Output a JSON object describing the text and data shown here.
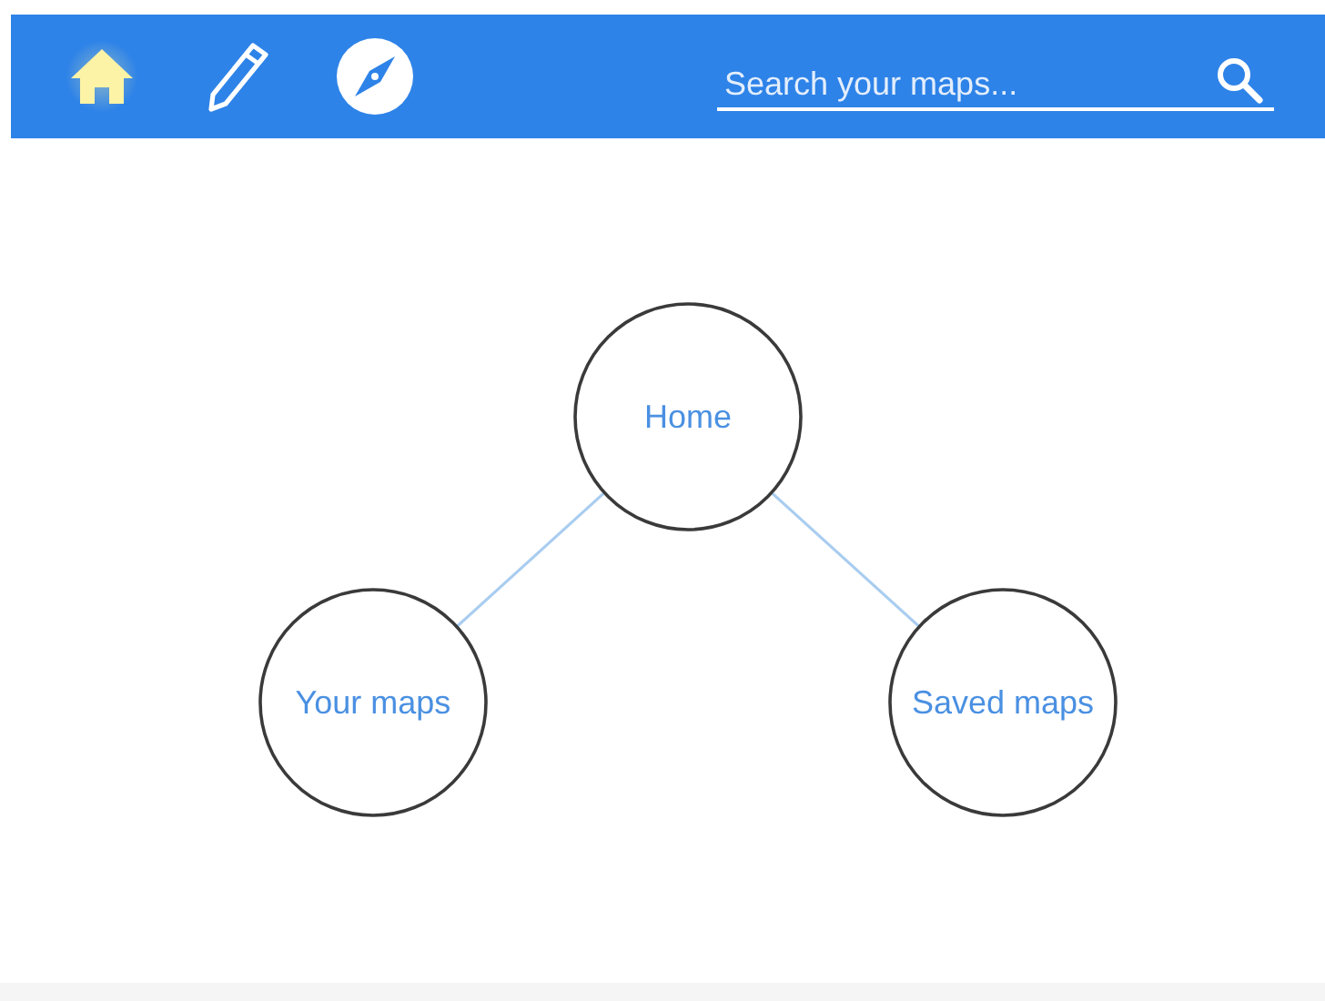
{
  "toolbar": {
    "items": [
      {
        "kind": "home",
        "selected": true
      },
      {
        "kind": "pencil",
        "selected": false
      },
      {
        "kind": "compass",
        "selected": false
      }
    ],
    "search": {
      "placeholder": "Search your maps..."
    }
  },
  "mind_map": {
    "label": "Home",
    "children": [
      {
        "label": "Your maps"
      },
      {
        "label": "Saved maps"
      }
    ]
  }
}
